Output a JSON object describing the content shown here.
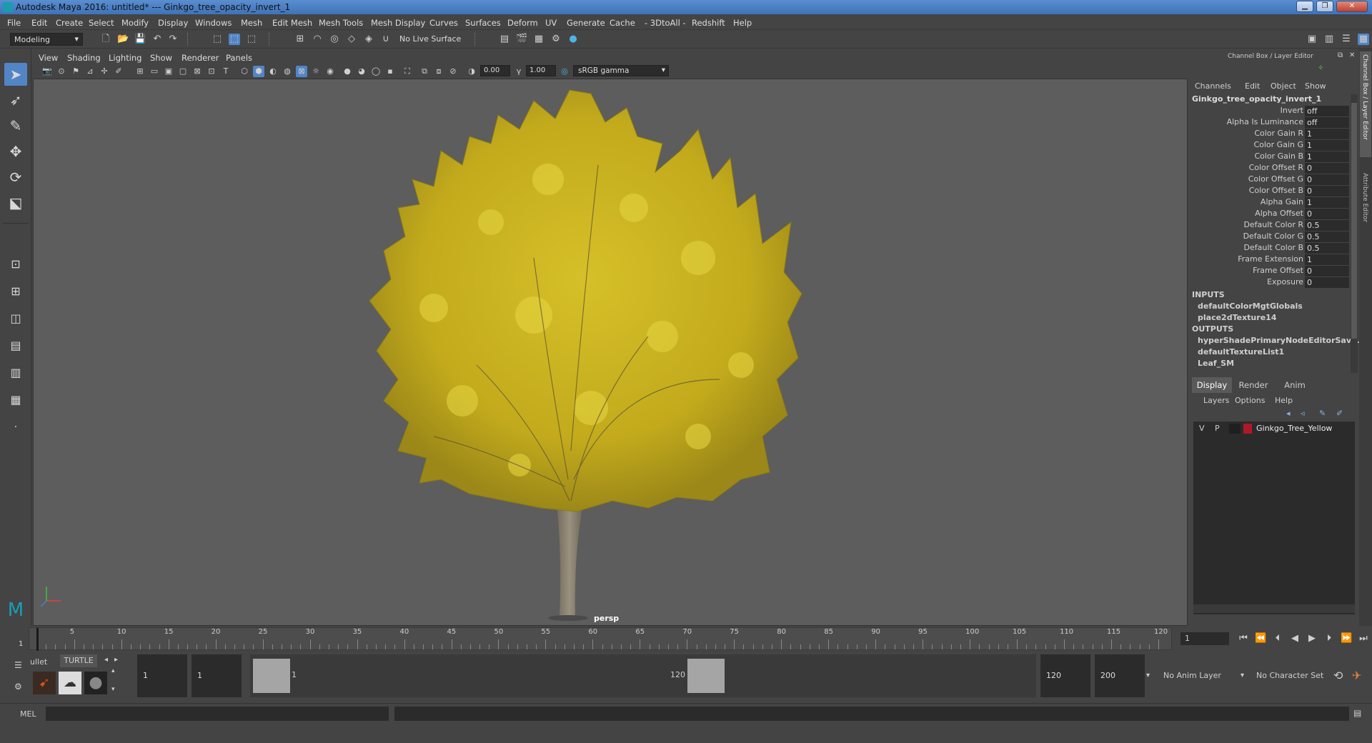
{
  "window": {
    "title": "Autodesk Maya 2016: untitled*   ---   Ginkgo_tree_opacity_invert_1",
    "min_label": "▁",
    "max_label": "❐",
    "close_label": "✕"
  },
  "menubar": [
    "File",
    "Edit",
    "Create",
    "Select",
    "Modify",
    "Display",
    "Windows",
    "Mesh",
    "Edit Mesh",
    "Mesh Tools",
    "Mesh Display",
    "Curves",
    "Surfaces",
    "Deform",
    "UV",
    "Generate",
    "Cache",
    "- 3DtoAll -",
    "Redshift",
    "Help"
  ],
  "statusline": {
    "mode": "Modeling",
    "live_surface": "No Live Surface"
  },
  "viewport": {
    "menu": [
      "View",
      "Shading",
      "Lighting",
      "Show",
      "Renderer",
      "Panels"
    ],
    "exposure_value": "0.00",
    "gamma_value": "1.00",
    "color_space": "sRGB gamma",
    "camera_label": "persp"
  },
  "channel_box": {
    "header": "Channel Box / Layer Editor",
    "menu": [
      "Channels",
      "Edit",
      "Object",
      "Show"
    ],
    "node_name": "Ginkgo_tree_opacity_invert_1",
    "attributes": [
      {
        "label": "Invert",
        "value": "off"
      },
      {
        "label": "Alpha Is Luminance",
        "value": "off"
      },
      {
        "label": "Color Gain R",
        "value": "1"
      },
      {
        "label": "Color Gain G",
        "value": "1"
      },
      {
        "label": "Color Gain B",
        "value": "1"
      },
      {
        "label": "Color Offset R",
        "value": "0"
      },
      {
        "label": "Color Offset G",
        "value": "0"
      },
      {
        "label": "Color Offset B",
        "value": "0"
      },
      {
        "label": "Alpha Gain",
        "value": "1"
      },
      {
        "label": "Alpha Offset",
        "value": "0"
      },
      {
        "label": "Default Color R",
        "value": "0.5"
      },
      {
        "label": "Default Color G",
        "value": "0.5"
      },
      {
        "label": "Default Color B",
        "value": "0.5"
      },
      {
        "label": "Frame Extension",
        "value": "1"
      },
      {
        "label": "Frame Offset",
        "value": "0"
      },
      {
        "label": "Exposure",
        "value": "0"
      }
    ],
    "inputs_header": "INPUTS",
    "inputs": [
      "defaultColorMgtGlobals",
      "place2dTexture14"
    ],
    "outputs_header": "OUTPUTS",
    "outputs": [
      "hyperShadePrimaryNodeEditorSave...",
      "defaultTextureList1",
      "Leaf_SM"
    ]
  },
  "layer_editor": {
    "tabs": [
      "Display",
      "Render",
      "Anim"
    ],
    "menu": [
      "Layers",
      "Options",
      "Help"
    ],
    "layer": {
      "v": "V",
      "p": "P",
      "name": "Ginkgo_Tree_Yellow",
      "color": "#b0182a"
    }
  },
  "side_tabs": {
    "channel_box": "Channel Box / Layer Editor",
    "attribute_editor": "Attribute Editor"
  },
  "timeline": {
    "ticks": [
      "5",
      "10",
      "15",
      "20",
      "25",
      "30",
      "35",
      "40",
      "45",
      "50",
      "55",
      "60",
      "65",
      "70",
      "75",
      "80",
      "85",
      "90",
      "95",
      "100",
      "105",
      "110",
      "115",
      "120"
    ],
    "start_label": "1",
    "current_frame": "1"
  },
  "shelf": {
    "tabs": [
      "ullet",
      "TURTLE"
    ]
  },
  "range": {
    "start_field": "1",
    "start_field2": "1",
    "range_start": "1",
    "range_end": "120",
    "end_field": "120",
    "end_field2": "200",
    "anim_layer": "No Anim Layer",
    "character_set": "No Character Set"
  },
  "mel": {
    "label": "MEL"
  },
  "colors": {
    "foliage": "#c9b21e",
    "trunk": "#8a8170",
    "accent": "#5285c6"
  }
}
